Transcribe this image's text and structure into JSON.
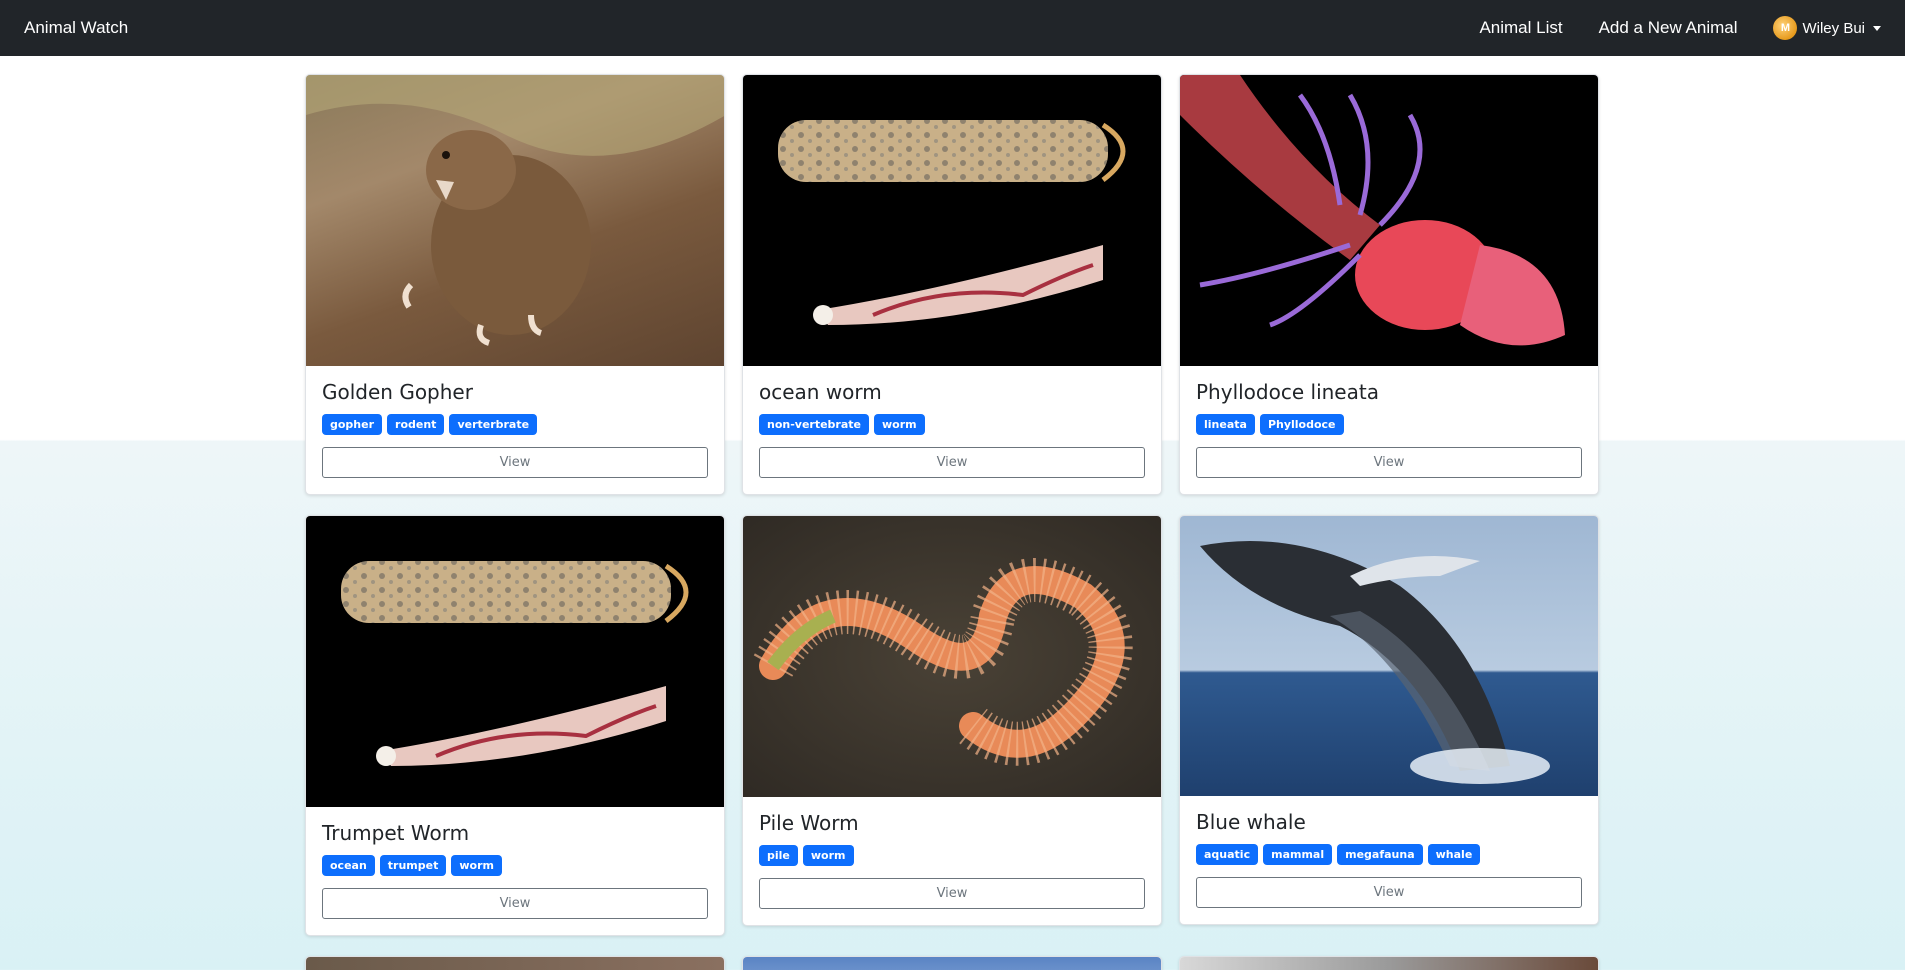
{
  "navbar": {
    "brand": "Animal Watch",
    "links": [
      "Animal List",
      "Add a New Animal"
    ],
    "user_name": "Wiley Bui"
  },
  "cards": [
    {
      "title": "Golden Gopher",
      "tags": [
        "gopher",
        "rodent",
        "verterbrate"
      ],
      "button": "View",
      "image": "gopher-photo"
    },
    {
      "title": "ocean worm",
      "tags": [
        "non-vertebrate",
        "worm"
      ],
      "button": "View",
      "image": "tube-worm-photo"
    },
    {
      "title": "Phyllodoce lineata",
      "tags": [
        "lineata",
        "Phyllodoce"
      ],
      "button": "View",
      "image": "red-worm-photo"
    },
    {
      "title": "Trumpet Worm",
      "tags": [
        "ocean",
        "trumpet",
        "worm"
      ],
      "button": "View",
      "image": "tube-worm-photo"
    },
    {
      "title": "Pile Worm",
      "tags": [
        "pile",
        "worm"
      ],
      "button": "View",
      "image": "bristle-worm-photo"
    },
    {
      "title": "Blue whale",
      "tags": [
        "aquatic",
        "mammal",
        "megafauna",
        "whale"
      ],
      "button": "View",
      "image": "whale-photo"
    }
  ]
}
